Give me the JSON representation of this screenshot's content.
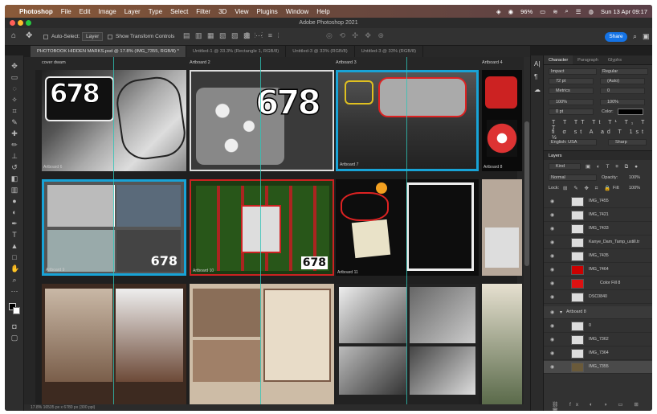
{
  "menubar": {
    "apple": "",
    "app": "Photoshop",
    "items": [
      "File",
      "Edit",
      "Image",
      "Layer",
      "Type",
      "Select",
      "Filter",
      "3D",
      "View",
      "Plugins",
      "Window",
      "Help"
    ],
    "battery": "96%",
    "datetime": "Sun 13 Apr 09:17"
  },
  "window": {
    "title": "Adobe Photoshop 2021"
  },
  "options": {
    "auto_select_label": "Auto-Select:",
    "auto_select_value": "Layer",
    "transform_label": "Show Transform Controls",
    "share_label": "Share"
  },
  "tabs": [
    "PHOTOBOOK HIDDEN MARKS.psd @ 17.8% (IMG_7355, RGB/8) *",
    "Untitled-1 @ 33.3% (Rectangle 1, RGB/8)",
    "Untitled-3 @ 33% (RGB/8)",
    "Untitled-3 @ 33% (RGB/8)"
  ],
  "artboards": {
    "row1": [
      "cover dwam",
      "Artboard 2",
      "Artboard 3",
      "Artboard 4"
    ],
    "row1_bottom": [
      "Artboard 6",
      "",
      "Artboard 7",
      "Artboard 8"
    ],
    "row2_bottom": [
      "Artboard 9",
      "Artboard 10",
      "Artboard 11"
    ],
    "tag_big": "678",
    "tag_small": "678"
  },
  "panel": {
    "tabs": [
      "Character",
      "Paragraph",
      "Glyphs"
    ],
    "font_family": "Impact",
    "font_style": "Regular",
    "size": "72 pt",
    "leading": "(Auto)",
    "kerning": "Metrics",
    "tracking": "0",
    "vscale": "100%",
    "hscale": "100%",
    "baseline": "0 pt",
    "color_label": "Color:",
    "language": "English: USA",
    "aa": "Sharp",
    "layers_tab": "Layers",
    "kind": "Kind",
    "blend": "Normal",
    "opacity_label": "Opacity:",
    "opacity": "100%",
    "lock_label": "Lock:",
    "fill_label": "Fill:",
    "fill": "100%",
    "layers": [
      "IMG_7455",
      "IMG_7421",
      "IMG_7433",
      "Kanye_Dam_Tamp_ustill.tr",
      "IMG_7435",
      "IMG_7464",
      "Color Fill 8",
      "DSC0840",
      "Artboard 8",
      "0",
      "IMG_7362",
      "IMG_7364",
      "IMG_7355"
    ]
  },
  "status": {
    "text": "17.8%    16535 px x 6780 px (300 ppi)"
  }
}
